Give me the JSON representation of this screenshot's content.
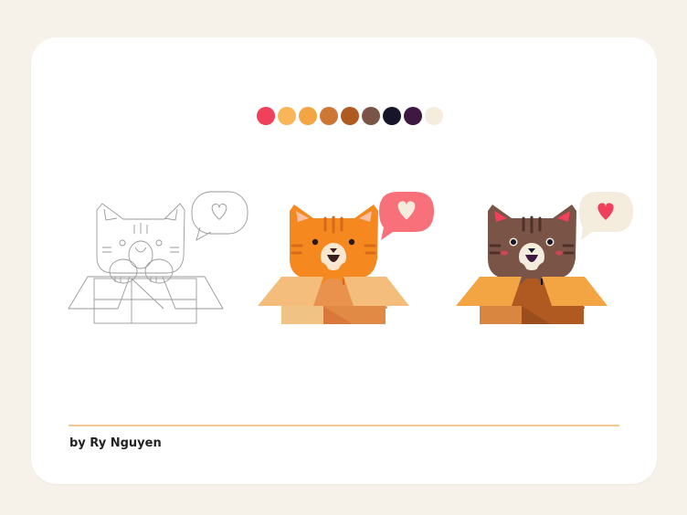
{
  "palette": {
    "colors": [
      "#f0405b",
      "#f8b658",
      "#f3a443",
      "#cd7736",
      "#b05a22",
      "#7a5446",
      "#16152a",
      "#3d1840",
      "#f4ecdd"
    ]
  },
  "illustrations": [
    {
      "name": "sketch",
      "style": "line-art",
      "stroke": "#9a9a9a",
      "icon": "heart-icon"
    },
    {
      "name": "orange-cat",
      "cat_color": "#f5891f",
      "box_color": "#f4bd7b",
      "bubble_color": "#f7707a",
      "heart_color": "#f4ecdd",
      "icon": "heart-icon"
    },
    {
      "name": "brown-cat",
      "cat_color": "#7a5446",
      "box_color": "#f2a648",
      "bubble_color": "#f4ecdd",
      "heart_color": "#f0405b",
      "icon": "heart-icon"
    }
  ],
  "divider_color": "#f5c890",
  "credit": "by Ry Nguyen"
}
